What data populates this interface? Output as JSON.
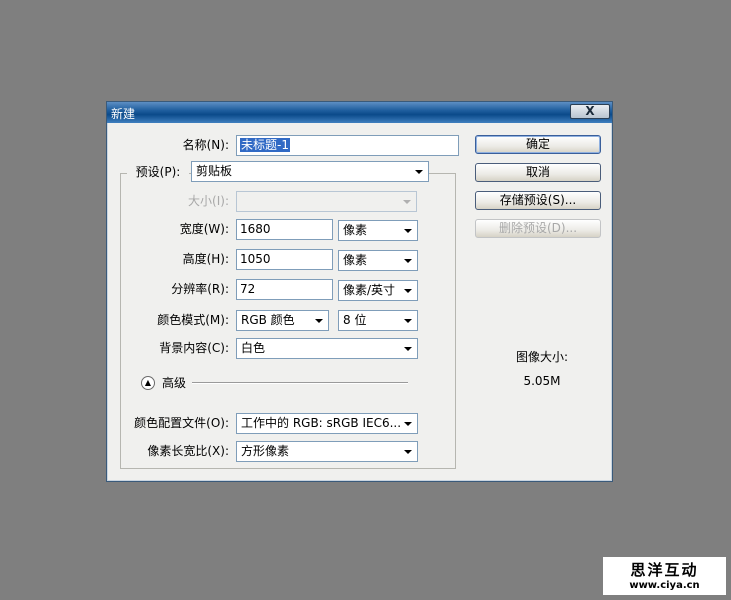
{
  "dialog": {
    "title": "新建",
    "close_label": "X"
  },
  "form": {
    "name_label": "名称(N):",
    "name_value": "未标题-1",
    "preset_label": "预设(P):",
    "preset_value": "剪贴板",
    "size_label": "大小(I):",
    "size_value": "",
    "width_label": "宽度(W):",
    "width_value": "1680",
    "width_unit": "像素",
    "height_label": "高度(H):",
    "height_value": "1050",
    "height_unit": "像素",
    "resolution_label": "分辨率(R):",
    "resolution_value": "72",
    "resolution_unit": "像素/英寸",
    "color_mode_label": "颜色模式(M):",
    "color_mode_value": "RGB 颜色",
    "bit_depth_value": "8 位",
    "background_label": "背景内容(C):",
    "background_value": "白色",
    "advanced_label": "高级",
    "color_profile_label": "颜色配置文件(O):",
    "color_profile_value": "工作中的 RGB: sRGB IEC6...",
    "pixel_aspect_label": "像素长宽比(X):",
    "pixel_aspect_value": "方形像素"
  },
  "buttons": {
    "ok": "确定",
    "cancel": "取消",
    "save_preset": "存储预设(S)...",
    "delete_preset": "删除预设(D)..."
  },
  "image_size": {
    "label": "图像大小:",
    "value": "5.05M"
  },
  "watermark": {
    "cn": "思洋互动",
    "url": "www.ciya.cn"
  }
}
